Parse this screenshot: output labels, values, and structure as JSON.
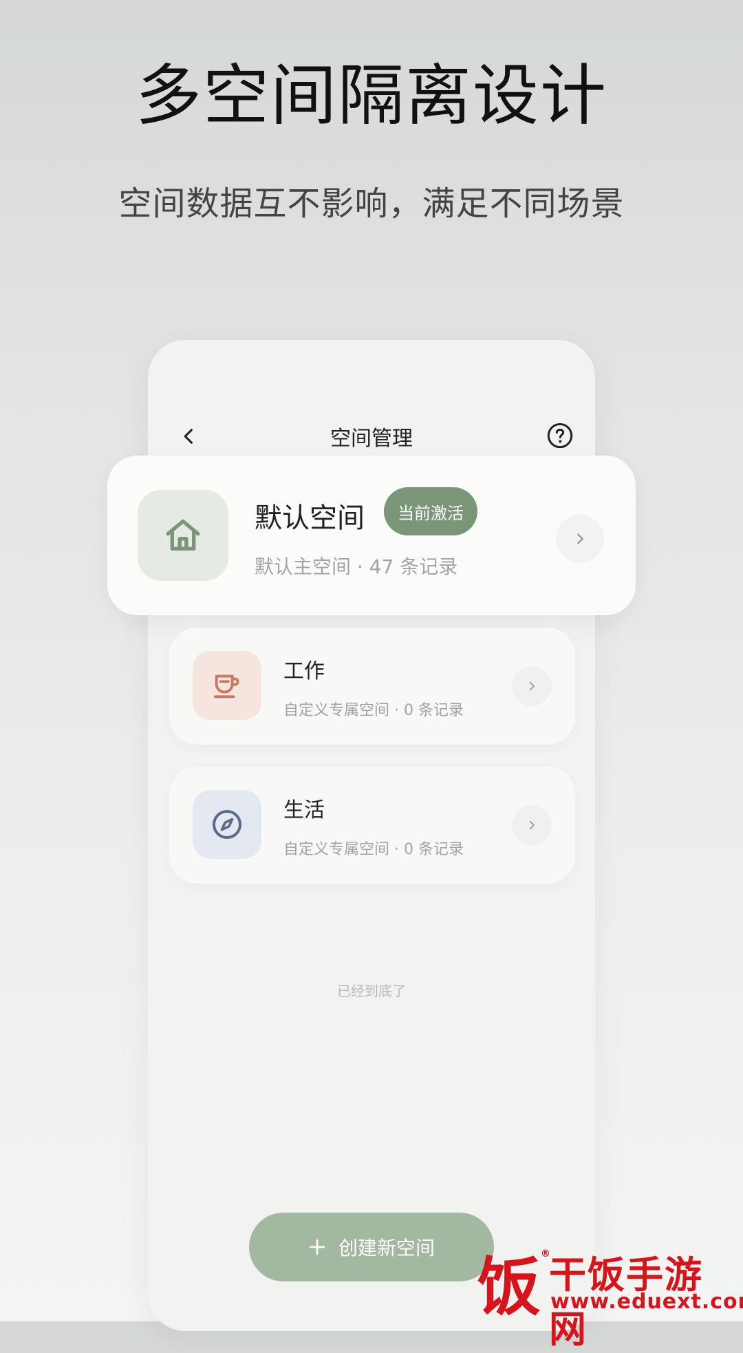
{
  "hero": {
    "title": "多空间隔离设计",
    "subtitle": "空间数据互不影响，满足不同场景"
  },
  "topbar": {
    "title": "空间管理",
    "back_icon": "chevron-left-icon",
    "help_icon": "help-circle-icon"
  },
  "colors": {
    "accent_green": "#7b9578",
    "create_button": "#a3b8a0",
    "work_tile_bg": "#f6e4de",
    "work_icon": "#c8785f",
    "life_tile_bg": "#e4e8f0",
    "life_icon": "#5a6a88",
    "home_tile_bg": "#e5eae4",
    "home_icon": "#7b9578",
    "watermark_red": "#d5151b"
  },
  "spaces": [
    {
      "title": "默认空间",
      "badge": "当前激活",
      "meta": "默认主空间 · 47 条记录",
      "icon": "home-icon"
    },
    {
      "title": "工作",
      "meta": "自定义专属空间 · 0 条记录",
      "icon": "cup-icon"
    },
    {
      "title": "生活",
      "meta": "自定义专属空间 · 0 条记录",
      "icon": "compass-icon"
    }
  ],
  "list_end": "已经到底了",
  "create_button": {
    "icon": "plus-icon",
    "label": "创建新空间"
  },
  "watermark": {
    "logo_char": "饭",
    "reg": "®",
    "name": "干饭手游网",
    "url": "www.eduext.com"
  }
}
